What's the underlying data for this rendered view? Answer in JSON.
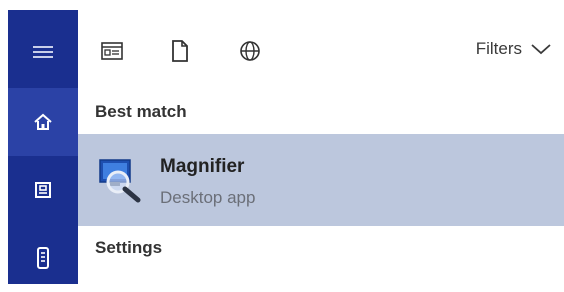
{
  "rail": {
    "items": [
      {
        "icon": "hamburger-menu-icon"
      },
      {
        "icon": "home-icon"
      },
      {
        "icon": "documents-icon"
      },
      {
        "icon": "device-icon"
      }
    ]
  },
  "toolbar": {
    "filters_label": "Filters",
    "icons": [
      "apps-icon",
      "document-icon",
      "web-globe-icon"
    ]
  },
  "results": {
    "best_match_header": "Best match",
    "best_match_item": {
      "title": "Magnifier",
      "subtitle": "Desktop app",
      "icon": "magnifier-app-icon"
    },
    "settings_header": "Settings"
  },
  "colors": {
    "rail_bg": "#1a2f8f",
    "rail_active": "#2b42a6",
    "selection_bg": "#bcc7dd"
  }
}
